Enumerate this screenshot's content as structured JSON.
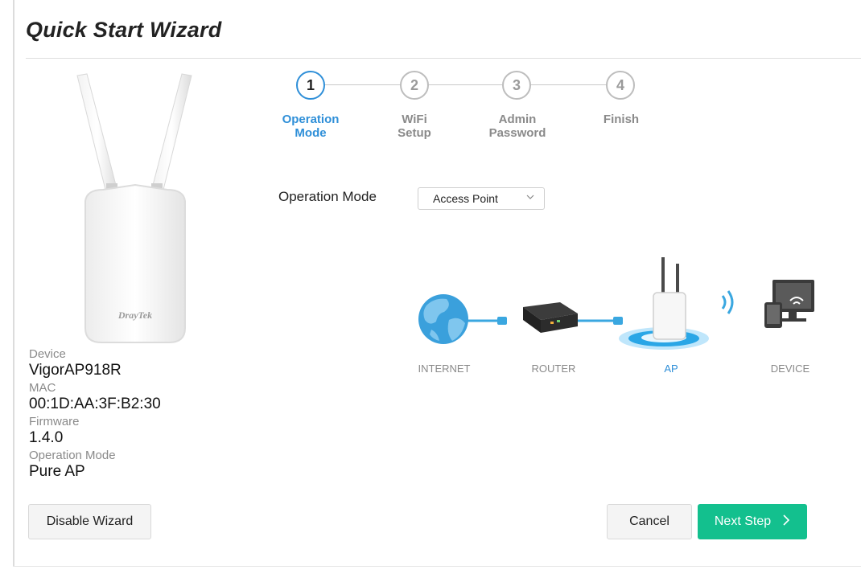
{
  "page": {
    "title": "Quick Start Wizard"
  },
  "stepper": {
    "steps": [
      {
        "number": "1",
        "line1": "Operation",
        "line2": "Mode",
        "active": true
      },
      {
        "number": "2",
        "line1": "WiFi",
        "line2": "Setup",
        "active": false
      },
      {
        "number": "3",
        "line1": "Admin",
        "line2": "Password",
        "active": false
      },
      {
        "number": "4",
        "line1": "Finish",
        "line2": "",
        "active": false
      }
    ]
  },
  "device_image": {
    "brand": "DrayTek"
  },
  "device_info": {
    "device_label": "Device",
    "device_value": "VigorAP918R",
    "mac_label": "MAC",
    "mac_value": "00:1D:AA:3F:B2:30",
    "firmware_label": "Firmware",
    "firmware_value": "1.4.0",
    "mode_label": "Operation Mode",
    "mode_value": "Pure AP"
  },
  "operation_mode": {
    "label": "Operation Mode",
    "selected": "Access Point",
    "icon": "chevron-down-icon"
  },
  "diagram": {
    "internet": "INTERNET",
    "router": "ROUTER",
    "ap": "AP",
    "device": "DEVICE"
  },
  "buttons": {
    "disable_wizard": "Disable Wizard",
    "cancel": "Cancel",
    "next": "Next Step",
    "next_icon": "chevron-right-icon"
  },
  "colors": {
    "accent": "#2f8fd8",
    "primary_button": "#13c08e"
  }
}
